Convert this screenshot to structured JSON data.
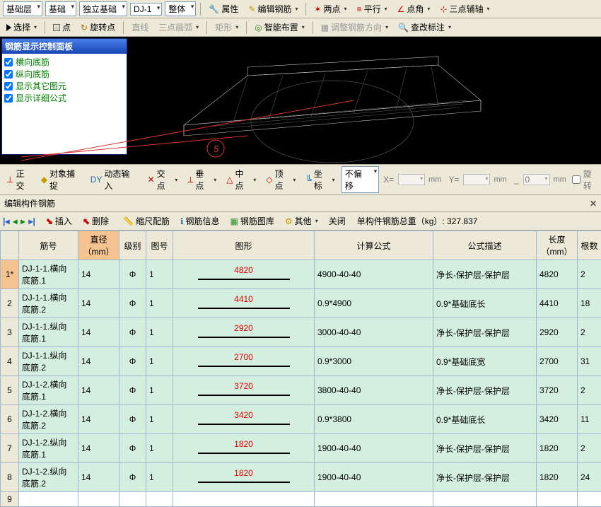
{
  "toolbar1": {
    "layer": "基础层",
    "type": "基础",
    "foundation": "独立基础",
    "element": "DJ-1",
    "view": "整体",
    "props": "属性",
    "edit_rebar": "编辑钢筋",
    "two_pt": "两点",
    "parallel": "平行",
    "pt_angle": "点角",
    "three_pt": "三点辅轴"
  },
  "toolbar2": {
    "select": "选择",
    "pt": "点",
    "rot_pt": "旋转点",
    "line": "直线",
    "arc": "三点画弧",
    "rect": "矩形",
    "smart": "智能布置",
    "adjust": "调整钢筋方向",
    "note": "查改标注"
  },
  "panel": {
    "title": "钢筋显示控制面板",
    "items": [
      "横向底筋",
      "纵向底筋",
      "显示其它图元",
      "显示详细公式"
    ]
  },
  "statusbar": {
    "ortho": "正交",
    "osnap": "对象捕捉",
    "dyn": "动态输入",
    "intersect": "交点",
    "perp": "垂点",
    "mid": "中点",
    "peak": "顶点",
    "coord": "坐标",
    "offset_mode": "不偏移",
    "x_label": "X=",
    "y_label": "Y=",
    "a_label": "_",
    "a_val": "0",
    "unit": "mm",
    "rotate": "旋转"
  },
  "section": {
    "title": "编辑构件钢筋"
  },
  "bar3": {
    "insert": "插入",
    "delete": "删除",
    "fit": "缩尺配筋",
    "info": "钢筋信息",
    "lib": "钢筋图库",
    "other": "其他",
    "close": "关闭",
    "total": "单构件钢筋总重（kg）: 327.837"
  },
  "cols": {
    "no": "筋号",
    "dia": "直径（mm）",
    "grade": "级别",
    "pic": "图号",
    "shape": "图形",
    "formula": "计算公式",
    "desc": "公式描述",
    "len": "长度（mm）",
    "qty": "根数"
  },
  "rows": [
    {
      "idx": "1*",
      "name": "DJ-1-1.横向底筋.1",
      "dia": "14",
      "grade": "Φ",
      "pic": "1",
      "shape": "4820",
      "formula": "4900-40-40",
      "desc": "净长-保护层-保护层",
      "len": "4820",
      "qty": "2"
    },
    {
      "idx": "2",
      "name": "DJ-1-1.横向底筋.2",
      "dia": "14",
      "grade": "Φ",
      "pic": "1",
      "shape": "4410",
      "formula": "0.9*4900",
      "desc": "0.9*基础底长",
      "len": "4410",
      "qty": "18"
    },
    {
      "idx": "3",
      "name": "DJ-1-1.纵向底筋.1",
      "dia": "14",
      "grade": "Φ",
      "pic": "1",
      "shape": "2920",
      "formula": "3000-40-40",
      "desc": "净长-保护层-保护层",
      "len": "2920",
      "qty": "2"
    },
    {
      "idx": "4",
      "name": "DJ-1-1.纵向底筋.2",
      "dia": "14",
      "grade": "Φ",
      "pic": "1",
      "shape": "2700",
      "formula": "0.9*3000",
      "desc": "0.9*基础底宽",
      "len": "2700",
      "qty": "31"
    },
    {
      "idx": "5",
      "name": "DJ-1-2.横向底筋.1",
      "dia": "14",
      "grade": "Φ",
      "pic": "1",
      "shape": "3720",
      "formula": "3800-40-40",
      "desc": "净长-保护层-保护层",
      "len": "3720",
      "qty": "2"
    },
    {
      "idx": "6",
      "name": "DJ-1-2.横向底筋.2",
      "dia": "14",
      "grade": "Φ",
      "pic": "1",
      "shape": "3420",
      "formula": "0.9*3800",
      "desc": "0.9*基础底长",
      "len": "3420",
      "qty": "11"
    },
    {
      "idx": "7",
      "name": "DJ-1-2.纵向底筋.1",
      "dia": "14",
      "grade": "Φ",
      "pic": "1",
      "shape": "1820",
      "formula": "1900-40-40",
      "desc": "净长-保护层-保护层",
      "len": "1820",
      "qty": "2"
    },
    {
      "idx": "8",
      "name": "DJ-1-2.纵向底筋.2",
      "dia": "14",
      "grade": "Φ",
      "pic": "1",
      "shape": "1820",
      "formula": "1900-40-40",
      "desc": "净长-保护层-保护层",
      "len": "1820",
      "qty": "24"
    }
  ],
  "marker": "5"
}
